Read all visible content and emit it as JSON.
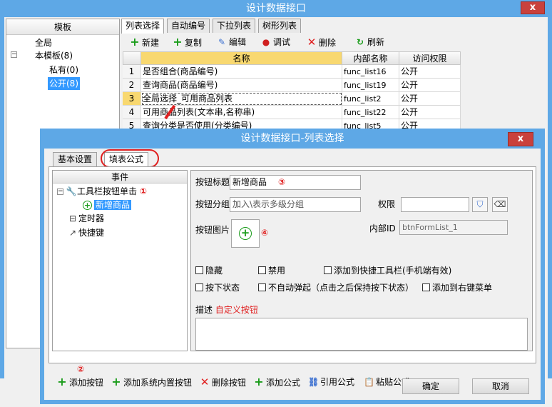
{
  "outer": {
    "title": "设计数据接口",
    "close_label": "x",
    "tree": {
      "header": "模板",
      "items": [
        {
          "label": "全局"
        },
        {
          "label": "本模板(8)"
        },
        {
          "label": "私有(0)"
        },
        {
          "label": "公开(8)",
          "selected": true
        }
      ]
    },
    "tabs": [
      {
        "label": "列表选择",
        "active": true
      },
      {
        "label": "自动编号"
      },
      {
        "label": "下拉列表"
      },
      {
        "label": "树形列表"
      }
    ],
    "toolbar": {
      "new": "新建",
      "copy": "复制",
      "edit": "编辑",
      "debug": "调试",
      "delete": "删除",
      "refresh": "刷新"
    },
    "grid": {
      "headers": [
        "名称",
        "内部名称",
        "访问权限"
      ],
      "rows": [
        {
          "num": "1",
          "name": "是否组合(商品编号)",
          "internal": "func_list16",
          "access": "公开"
        },
        {
          "num": "2",
          "name": "查询商品(商品编号)",
          "internal": "func_list19",
          "access": "公开"
        },
        {
          "num": "3",
          "name": "全局选择_可用商品列表",
          "internal": "func_list2",
          "access": "公开"
        },
        {
          "num": "4",
          "name": "可用商品列表(文本串,名称串)",
          "internal": "func_list22",
          "access": "公开"
        },
        {
          "num": "5",
          "name": "查询分类是否使用(分类编号)",
          "internal": "func_list5",
          "access": "公开"
        }
      ]
    }
  },
  "dialog": {
    "title": "设计数据接口-列表选择",
    "close_label": "x",
    "tabs": [
      {
        "label": "基本设置"
      },
      {
        "label": "填表公式",
        "active": true
      }
    ],
    "events": {
      "header": "事件",
      "items": [
        {
          "label": "工具栏按钮单击",
          "icon": "wrench-icon"
        },
        {
          "label": "新增商品",
          "icon": "add-circle-icon",
          "selected": true
        },
        {
          "label": "定时器",
          "icon": "timer-icon"
        },
        {
          "label": "快捷键",
          "icon": "shortcut-icon"
        }
      ]
    },
    "form": {
      "button_title_label": "按钮标题",
      "button_title_value": "新增商品",
      "button_group_label": "按钮分组",
      "button_group_placeholder": "加入\\表示多级分组",
      "permission_label": "权限",
      "permission_value": "",
      "button_image_label": "按钮图片",
      "internal_id_label": "内部ID",
      "internal_id_value": "btnFormList_1",
      "checkboxes": [
        {
          "label": "隐藏",
          "checked": false
        },
        {
          "label": "禁用",
          "checked": false
        },
        {
          "label": "添加到快捷工具栏(手机端有效)",
          "checked": false
        },
        {
          "label": "按下状态",
          "checked": false
        },
        {
          "label": "不自动弹起（点击之后保持按下状态）",
          "checked": false
        },
        {
          "label": "添加到右键菜单",
          "checked": false
        }
      ],
      "desc_label": "描述",
      "desc_hint": "自定义按钮"
    },
    "toolbar": {
      "add_button": "添加按钮",
      "add_system_button": "添加系统内置按钮",
      "delete_button": "删除按钮",
      "add_formula": "添加公式",
      "reference_formula": "引用公式",
      "paste_formula": "粘贴公式"
    },
    "ok_label": "确定",
    "cancel_label": "取消",
    "annotations": {
      "n1": "①",
      "n2": "②",
      "n3": "③",
      "n4": "④"
    }
  }
}
